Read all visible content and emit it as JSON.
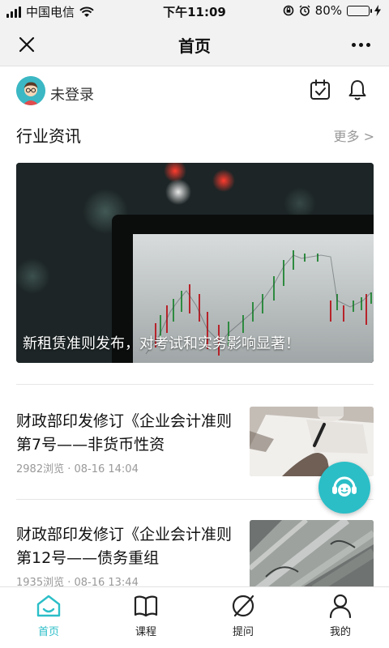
{
  "status_bar": {
    "carrier": "中国电信",
    "time": "下午11:09",
    "battery": "80%",
    "battery_level": 0.8
  },
  "nav": {
    "title": "首页",
    "close_icon": "close-icon",
    "more_icon": "more-icon"
  },
  "user": {
    "name": "未登录"
  },
  "section": {
    "title": "行业资讯",
    "more": "更多 >"
  },
  "hero": {
    "caption": "新租赁准则发布，对考试和实务影响显著！"
  },
  "news": [
    {
      "title": "财政部印发修订《企业会计准则第7号——非货币性资",
      "meta": "2982浏览 · 08-16 14:04"
    },
    {
      "title": "财政部印发修订《企业会计准则第12号——债务重组",
      "meta": "1935浏览 · 08-16 13:44"
    }
  ],
  "tabs": [
    {
      "label": "首页",
      "icon": "home-icon",
      "active": true
    },
    {
      "label": "课程",
      "icon": "book-icon",
      "active": false
    },
    {
      "label": "提问",
      "icon": "question-icon",
      "active": false
    },
    {
      "label": "我的",
      "icon": "person-icon",
      "active": false
    }
  ],
  "colors": {
    "accent": "#2bbec7",
    "battery": "#4cd964"
  }
}
